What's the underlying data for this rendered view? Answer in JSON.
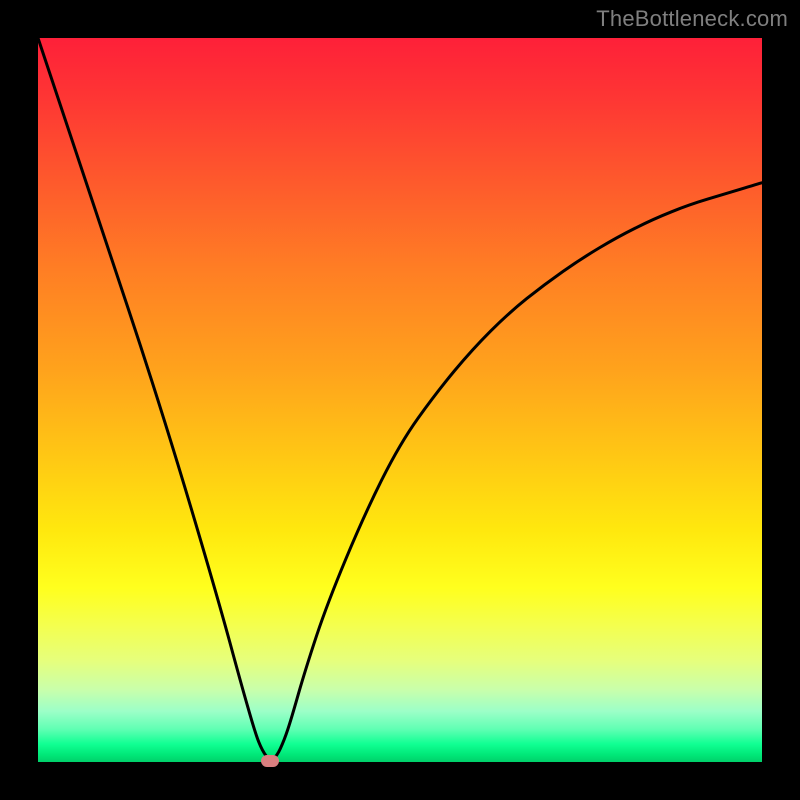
{
  "watermark": "TheBottleneck.com",
  "chart_data": {
    "type": "line",
    "title": "",
    "xlabel": "",
    "ylabel": "",
    "xlim": [
      0,
      100
    ],
    "ylim": [
      0,
      100
    ],
    "grid": false,
    "legend": false,
    "background": {
      "gradient": "vertical",
      "stops": [
        {
          "pos": 0,
          "color": "#fe2039"
        },
        {
          "pos": 20,
          "color": "#fe5a2c"
        },
        {
          "pos": 46,
          "color": "#ffa31c"
        },
        {
          "pos": 68,
          "color": "#ffe80e"
        },
        {
          "pos": 86,
          "color": "#e6ff7c"
        },
        {
          "pos": 97,
          "color": "#11ff93"
        },
        {
          "pos": 100,
          "color": "#00d06a"
        }
      ]
    },
    "series": [
      {
        "name": "bottleneck-curve",
        "color": "#000000",
        "x": [
          0,
          5,
          10,
          15,
          20,
          25,
          28,
          30,
          31,
          32,
          33,
          34,
          35,
          37,
          40,
          45,
          50,
          55,
          60,
          65,
          70,
          75,
          80,
          85,
          90,
          95,
          100
        ],
        "y": [
          100,
          85,
          70,
          55,
          39,
          22,
          11,
          4,
          1.5,
          0.2,
          0.8,
          3,
          6,
          13,
          22,
          34,
          44,
          51,
          57,
          62,
          66,
          69.5,
          72.5,
          75,
          77,
          78.5,
          80
        ]
      }
    ],
    "annotations": [
      {
        "name": "min-marker",
        "shape": "rounded-dot",
        "color": "#d98080",
        "x": 32,
        "y": 0.2
      }
    ]
  }
}
